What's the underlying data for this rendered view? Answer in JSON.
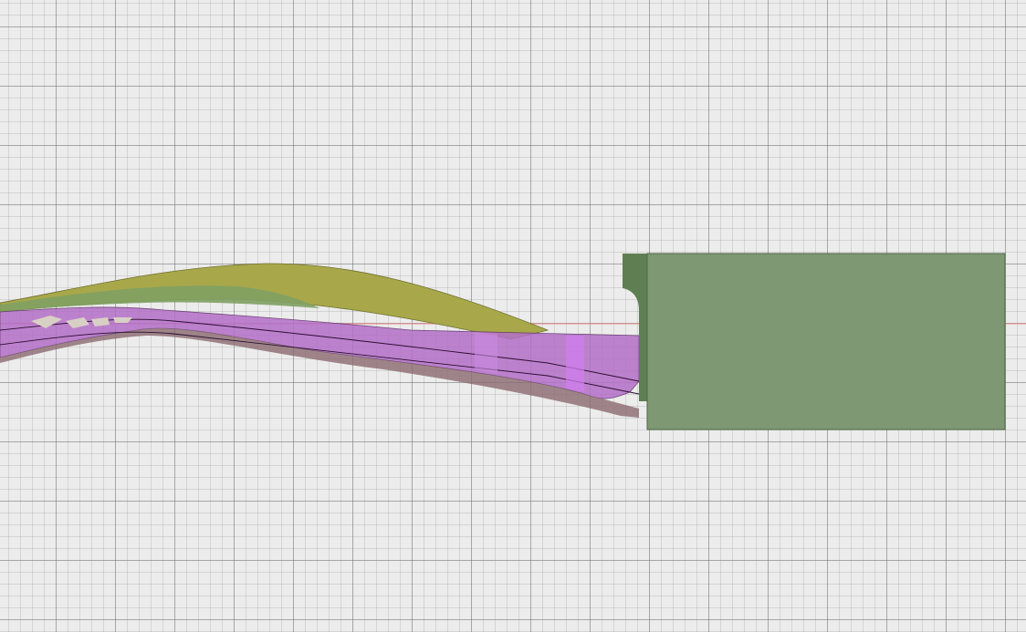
{
  "viewport": {
    "colors": {
      "background": "#ececec",
      "block": "#7d9873",
      "block_dark": "#5f7f52",
      "blade_yellow": "#a8a84a",
      "blade_green": "#7fa063",
      "blade_purple": "#b46fc8",
      "axis_red": "#f08a8a"
    }
  }
}
